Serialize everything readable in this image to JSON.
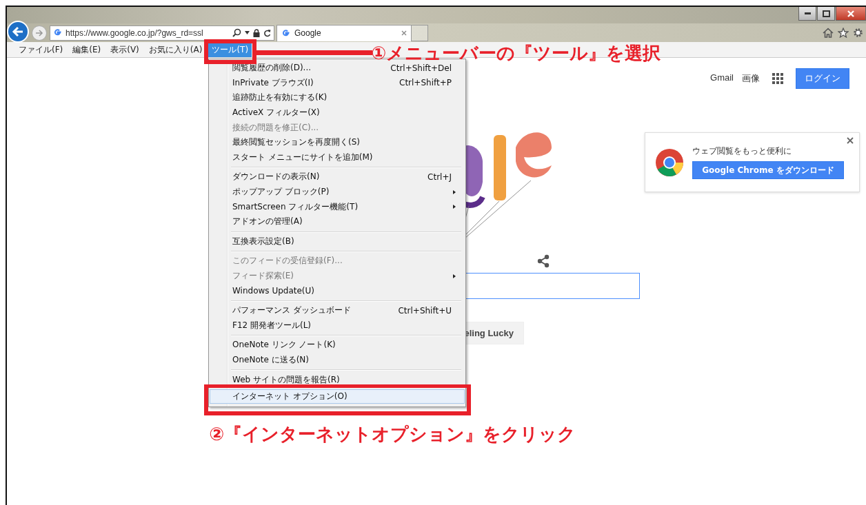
{
  "browser": {
    "address": "https://www.google.co.jp/?gws_rd=ssl",
    "tabs": [
      {
        "title": "Google"
      }
    ]
  },
  "menu_bar": [
    {
      "label": "ファイル(F)",
      "selected": false
    },
    {
      "label": "編集(E)",
      "selected": false
    },
    {
      "label": "表示(V)",
      "selected": false
    },
    {
      "label": "お気に入り(A)",
      "selected": false
    },
    {
      "label": "ツール(T)",
      "selected": true
    }
  ],
  "tools_menu": {
    "groups": [
      {
        "items": [
          {
            "label": "閲覧履歴の削除(D)...",
            "shortcut": "Ctrl+Shift+Del",
            "submenu": false,
            "disabled": false,
            "selected": false
          },
          {
            "label": "InPrivate ブラウズ(I)",
            "shortcut": "Ctrl+Shift+P",
            "submenu": false,
            "disabled": false,
            "selected": false
          },
          {
            "label": "追跡防止を有効にする(K)",
            "submenu": false,
            "disabled": false,
            "selected": false
          },
          {
            "label": "ActiveX フィルター(X)",
            "submenu": false,
            "disabled": false,
            "selected": false
          },
          {
            "label": "接続の問題を修正(C)...",
            "submenu": false,
            "disabled": true,
            "selected": false
          },
          {
            "label": "最終閲覧セッションを再度開く(S)",
            "submenu": false,
            "disabled": false,
            "selected": false
          },
          {
            "label": "スタート メニューにサイトを追加(M)",
            "submenu": false,
            "disabled": false,
            "selected": false
          }
        ]
      },
      {
        "items": [
          {
            "label": "ダウンロードの表示(N)",
            "shortcut": "Ctrl+J",
            "submenu": false,
            "disabled": false,
            "selected": false
          },
          {
            "label": "ポップアップ ブロック(P)",
            "submenu": true,
            "disabled": false,
            "selected": false
          },
          {
            "label": "SmartScreen フィルター機能(T)",
            "submenu": true,
            "disabled": false,
            "selected": false
          },
          {
            "label": "アドオンの管理(A)",
            "submenu": false,
            "disabled": false,
            "selected": false
          }
        ]
      },
      {
        "items": [
          {
            "label": "互換表示設定(B)",
            "submenu": false,
            "disabled": false,
            "selected": false
          }
        ]
      },
      {
        "items": [
          {
            "label": "このフィードの受信登録(F)...",
            "submenu": false,
            "disabled": true,
            "selected": false
          },
          {
            "label": "フィード探索(E)",
            "submenu": true,
            "disabled": true,
            "selected": false
          },
          {
            "label": "Windows Update(U)",
            "submenu": false,
            "disabled": false,
            "selected": false
          }
        ]
      },
      {
        "items": [
          {
            "label": "パフォーマンス ダッシュボード",
            "shortcut": "Ctrl+Shift+U",
            "submenu": false,
            "disabled": false,
            "selected": false
          },
          {
            "label": "F12 開発者ツール(L)",
            "submenu": false,
            "disabled": false,
            "selected": false
          }
        ]
      },
      {
        "items": [
          {
            "label": "OneNote リンク ノート(K)",
            "submenu": false,
            "disabled": false,
            "selected": false
          },
          {
            "label": "OneNote に送る(N)",
            "submenu": false,
            "disabled": false,
            "selected": false
          }
        ]
      },
      {
        "items": [
          {
            "label": "Web サイトの問題を報告(R)",
            "submenu": false,
            "disabled": false,
            "selected": false
          },
          {
            "label": "インターネット オプション(O)",
            "submenu": false,
            "disabled": false,
            "selected": true
          }
        ]
      }
    ]
  },
  "page": {
    "header_links": [
      "Gmail",
      "画像"
    ],
    "login_button": "ログイン",
    "lucky_button": "eling Lucky",
    "promo": {
      "text": "ウェブ閲覧をもっと便利に",
      "button": "Google Chrome をダウンロード"
    }
  },
  "annotations": [
    {
      "kind": "step",
      "text": "①メニューバーの『ツール』を選択"
    },
    {
      "kind": "step",
      "text": "②『インターネットオプション』をクリック"
    }
  ]
}
